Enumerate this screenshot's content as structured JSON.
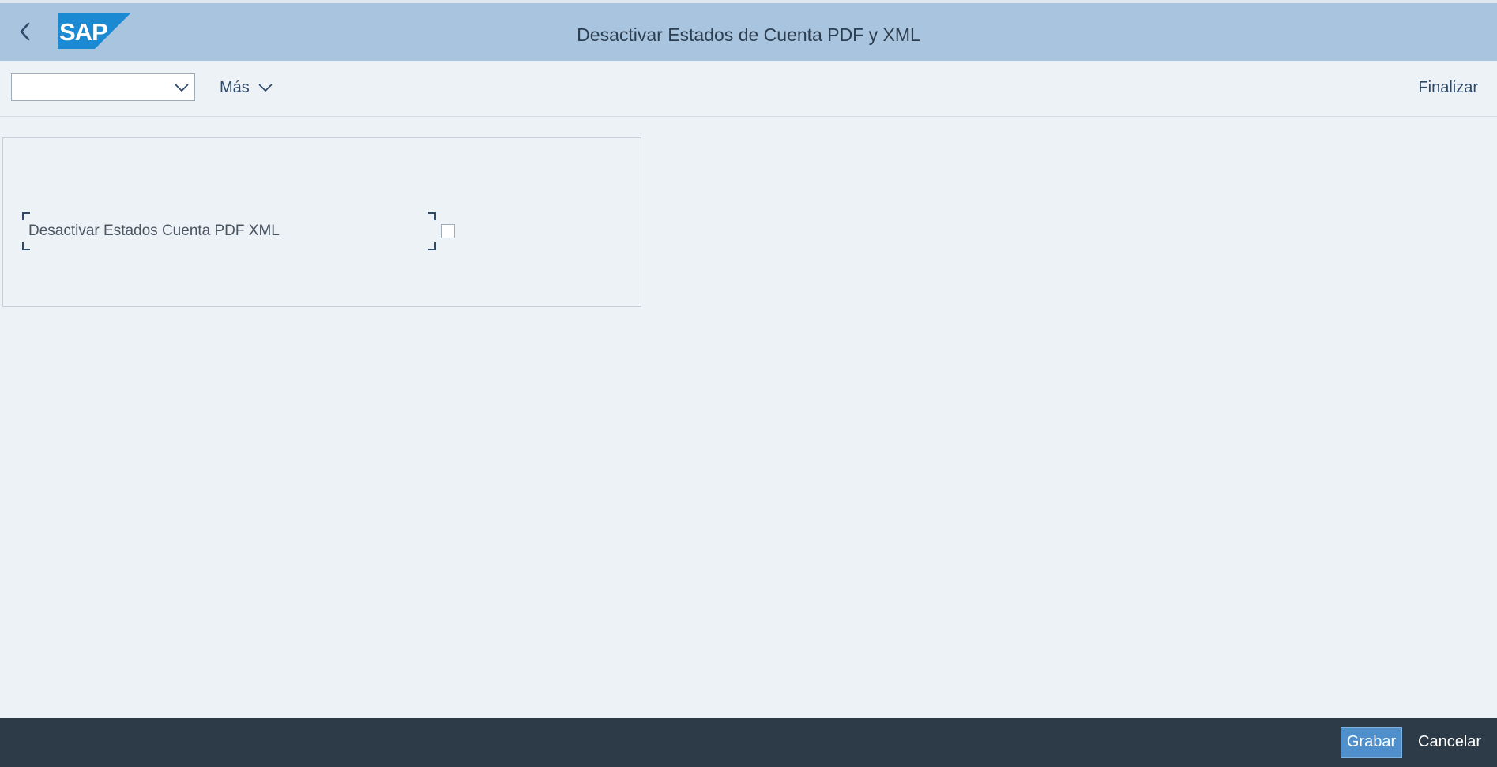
{
  "header": {
    "title": "Desactivar Estados de Cuenta PDF y XML",
    "back_icon": "chevron-left-icon",
    "logo_text": "SAP"
  },
  "toolbar": {
    "select_value": "",
    "more_label": "Más",
    "finish_label": "Finalizar"
  },
  "form": {
    "field_label": "Desactivar Estados Cuenta PDF XML",
    "checkbox_checked": false
  },
  "footer": {
    "save_label": "Grabar",
    "cancel_label": "Cancelar"
  },
  "colors": {
    "header_bg": "#a9c4de",
    "page_bg": "#edf2f7",
    "footer_bg": "#2d3a47",
    "primary_button": "#4f8fcc",
    "logo_blue": "#1b8ad2"
  }
}
